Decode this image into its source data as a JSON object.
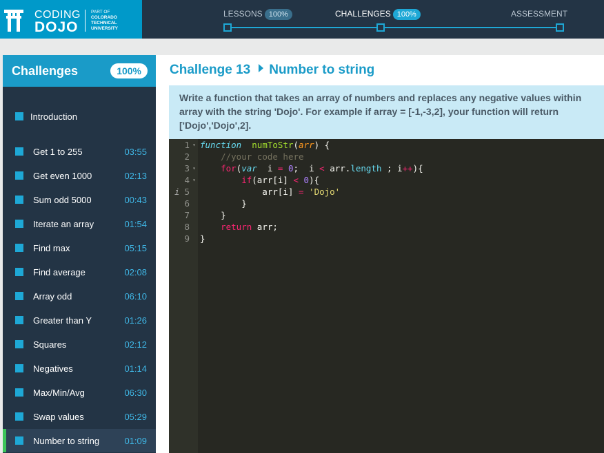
{
  "logo": {
    "line1": "CODING",
    "line2": "DOJO",
    "part": [
      "PART OF",
      "COLORADO",
      "TECHNICAL",
      "UNIVERSITY"
    ]
  },
  "progress": [
    {
      "label": "LESSONS",
      "badge": "100%"
    },
    {
      "label": "CHALLENGES",
      "badge": "100%"
    },
    {
      "label": "ASSESSMENT",
      "badge": ""
    }
  ],
  "sidebar": {
    "title": "Challenges",
    "badge": "100%",
    "items": [
      {
        "label": "Introduction",
        "time": ""
      },
      {
        "label": "Get 1 to 255",
        "time": "03:55"
      },
      {
        "label": "Get even 1000",
        "time": "02:13"
      },
      {
        "label": "Sum odd 5000",
        "time": "00:43"
      },
      {
        "label": "Iterate an array",
        "time": "01:54"
      },
      {
        "label": "Find max",
        "time": "05:15"
      },
      {
        "label": "Find average",
        "time": "02:08"
      },
      {
        "label": "Array odd",
        "time": "06:10"
      },
      {
        "label": "Greater than Y",
        "time": "01:26"
      },
      {
        "label": "Squares",
        "time": "02:12"
      },
      {
        "label": "Negatives",
        "time": "01:14"
      },
      {
        "label": "Max/Min/Avg",
        "time": "06:30"
      },
      {
        "label": "Swap values",
        "time": "05:29"
      },
      {
        "label": "Number to string",
        "time": "01:09"
      }
    ]
  },
  "challenge": {
    "number": "Challenge 13",
    "name": "Number to string",
    "description": [
      "Write a function that takes an array of numbers and replaces any negative values within",
      "array with the string 'Dojo'. For example if array = [-1,-3,2], your function will return",
      "['Dojo','Dojo',2]."
    ]
  },
  "editor": {
    "line_numbers": [
      "1",
      "2",
      "3",
      "4",
      "5",
      "6",
      "7",
      "8",
      "9"
    ],
    "lines": [
      [
        [
          "st",
          "function"
        ],
        [
          "",
          "  "
        ],
        [
          "fn",
          "numToStr"
        ],
        [
          "",
          "("
        ],
        [
          "pa",
          "arr"
        ],
        [
          "",
          ") {"
        ]
      ],
      [
        [
          "",
          "    "
        ],
        [
          "cm",
          "//your code here"
        ]
      ],
      [
        [
          "",
          "    "
        ],
        [
          "kw",
          "for"
        ],
        [
          "",
          "("
        ],
        [
          "st",
          "var"
        ],
        [
          "",
          ""
        ],
        [
          "",
          "  i "
        ],
        [
          "op",
          "="
        ],
        [
          "",
          ""
        ],
        [
          "nu",
          " 0"
        ],
        [
          "",
          ""
        ],
        [
          "",
          "",
          " "
        ],
        [
          "",
          ";"
        ],
        [
          "",
          ""
        ],
        [
          "",
          "  i "
        ],
        [
          "op",
          "<"
        ],
        [
          "",
          " arr."
        ],
        [
          "pr",
          "length"
        ],
        [
          "",
          " ; i"
        ],
        [
          "op",
          "++"
        ],
        [
          "",
          "){"
        ]
      ],
      [
        [
          "",
          "        "
        ],
        [
          "kw",
          "if"
        ],
        [
          "",
          "(arr[i] "
        ],
        [
          "op",
          "<"
        ],
        [
          "nu",
          " 0"
        ],
        [
          "",
          "){"
        ]
      ],
      [
        [
          "",
          "            arr[i] "
        ],
        [
          "op",
          "="
        ],
        [
          "sr",
          " 'Dojo'"
        ]
      ],
      [
        [
          "",
          "        }"
        ]
      ],
      [
        [
          "",
          "    }"
        ]
      ],
      [
        [
          "",
          "    "
        ],
        [
          "kw",
          "return"
        ],
        [
          "",
          " arr;"
        ]
      ],
      [
        [
          "",
          "}"
        ]
      ]
    ]
  }
}
